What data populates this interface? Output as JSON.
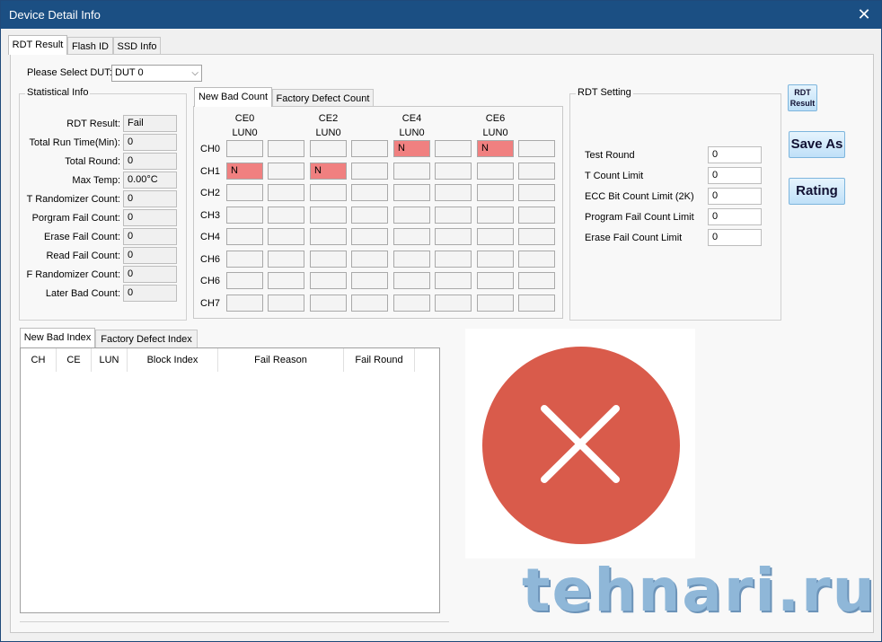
{
  "window": {
    "title": "Device Detail Info",
    "close_label": "✕"
  },
  "top_tabs": [
    {
      "label": "RDT Result"
    },
    {
      "label": "Flash ID"
    },
    {
      "label": "SSD Info"
    }
  ],
  "dut": {
    "label": "Please Select DUT:",
    "selected": "DUT 0"
  },
  "statistical": {
    "title": "Statistical Info",
    "rows": [
      {
        "label": "RDT Result:",
        "value": "Fail"
      },
      {
        "label": "Total Run Time(Min):",
        "value": "0"
      },
      {
        "label": "Total Round:",
        "value": "0"
      },
      {
        "label": "Max Temp:",
        "value": "0.00°C"
      },
      {
        "label": "T Randomizer Count:",
        "value": "0"
      },
      {
        "label": "Porgram Fail Count:",
        "value": "0"
      },
      {
        "label": "Erase Fail Count:",
        "value": "0"
      },
      {
        "label": "Read Fail Count:",
        "value": "0"
      },
      {
        "label": "F Randomizer Count:",
        "value": "0"
      },
      {
        "label": "Later Bad Count:",
        "value": "0"
      }
    ]
  },
  "count_tabs": [
    {
      "label": "New Bad Count"
    },
    {
      "label": "Factory Defect Count"
    }
  ],
  "grid": {
    "ce_headers": [
      "CE0",
      "CE2",
      "CE4",
      "CE6"
    ],
    "lun_headers": [
      "LUN0",
      "LUN0",
      "LUN0",
      "LUN0"
    ],
    "channels": [
      "CH0",
      "CH1",
      "CH2",
      "CH3",
      "CH4",
      "CH6",
      "CH6",
      "CH7"
    ],
    "rows": [
      [
        "",
        "",
        "",
        "",
        "N",
        "",
        "N",
        ""
      ],
      [
        "N",
        "",
        "N",
        "",
        "",
        "",
        "",
        ""
      ],
      [
        "",
        "",
        "",
        "",
        "",
        "",
        "",
        ""
      ],
      [
        "",
        "",
        "",
        "",
        "",
        "",
        "",
        ""
      ],
      [
        "",
        "",
        "",
        "",
        "",
        "",
        "",
        ""
      ],
      [
        "",
        "",
        "",
        "",
        "",
        "",
        "",
        ""
      ],
      [
        "",
        "",
        "",
        "",
        "",
        "",
        "",
        ""
      ],
      [
        "",
        "",
        "",
        "",
        "",
        "",
        "",
        ""
      ]
    ],
    "bad_color": "#f08080"
  },
  "rdt_setting": {
    "title": "RDT Setting",
    "rows": [
      {
        "label": "Test Round",
        "value": "0"
      },
      {
        "label": "T Count Limit",
        "value": "0"
      },
      {
        "label": "ECC Bit Count Limit (2K)",
        "value": "0"
      },
      {
        "label": "Program Fail Count Limit",
        "value": "0"
      },
      {
        "label": "Erase Fail Count Limit",
        "value": "0"
      }
    ]
  },
  "buttons": {
    "rdt_result_line1": "RDT",
    "rdt_result_line2": "Result",
    "save_as": "Save As",
    "rating": "Rating"
  },
  "index_tabs": [
    {
      "label": "New Bad Index"
    },
    {
      "label": "Factory Defect Index"
    }
  ],
  "index_table": {
    "columns": [
      "CH",
      "CE",
      "LUN",
      "Block Index",
      "Fail Reason",
      "Fail Round"
    ]
  },
  "result_icon": {
    "name": "fail-x-icon",
    "color": "#d95b4b"
  },
  "watermark": {
    "text": "tehnari.ru"
  }
}
